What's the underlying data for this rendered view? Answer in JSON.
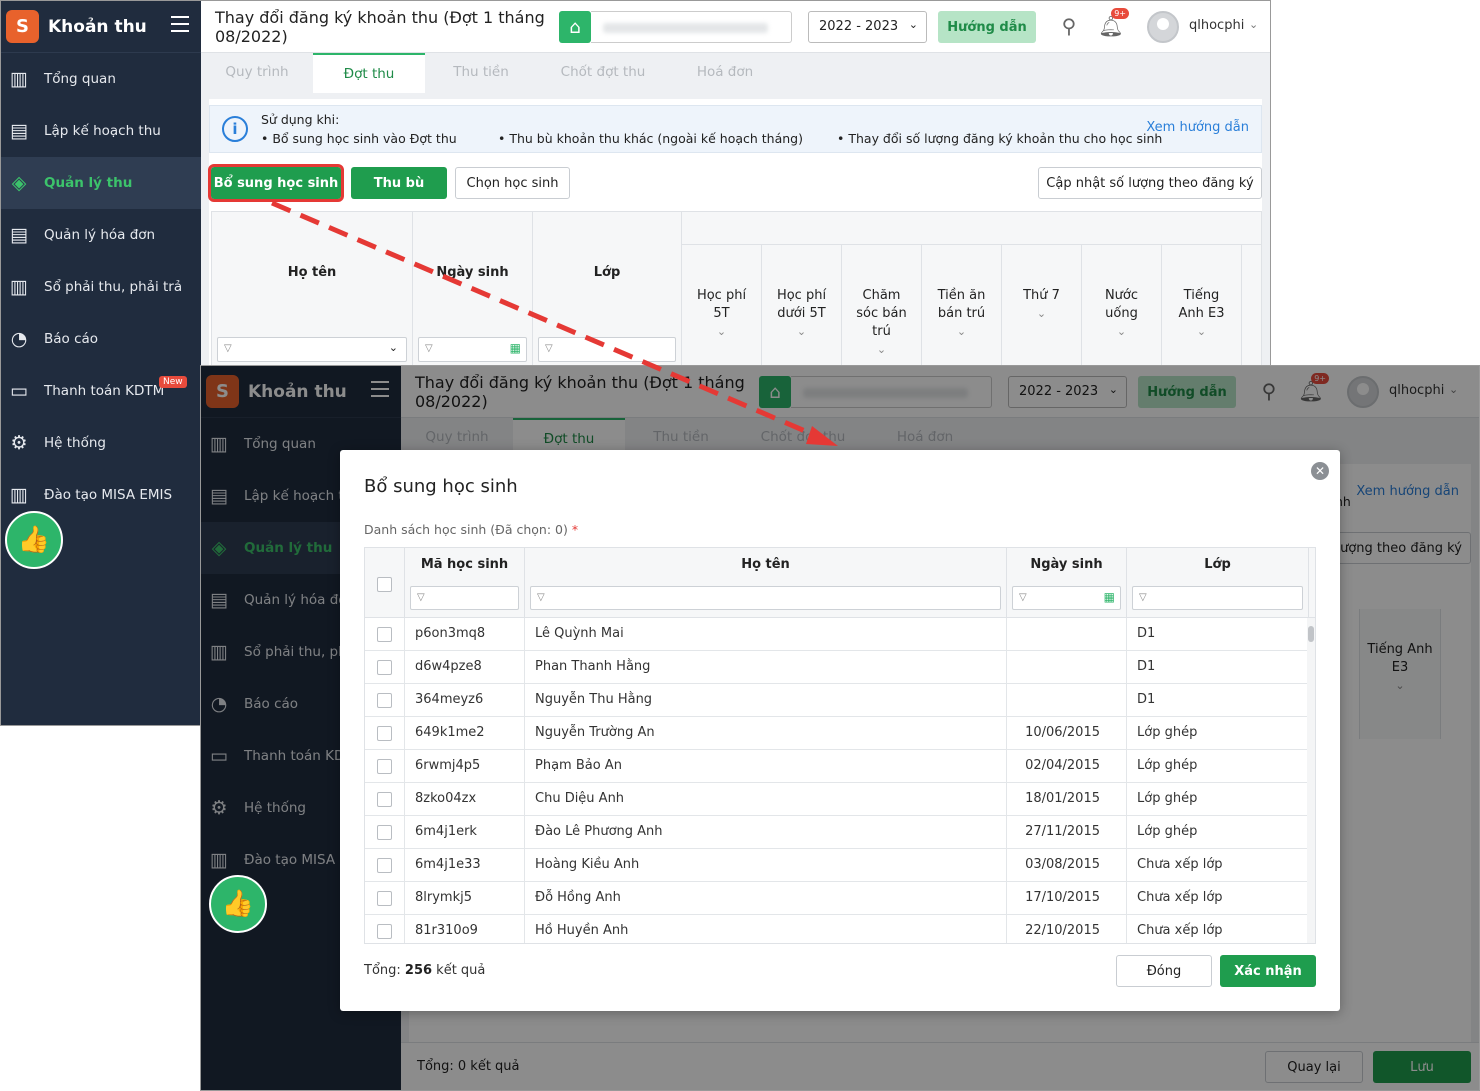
{
  "app": {
    "name": "Khoản thu",
    "logo_glyph": "S",
    "page_title": "Thay đổi đăng ký khoản thu (Đợt 1 tháng 08/2022)",
    "school_year": "2022 - 2023",
    "guide_label": "Hướng dẫn",
    "notif_count": "9+",
    "user_name": "qlhocphi",
    "accent_color": "#2db56a",
    "sidebar_color": "#202c3e"
  },
  "sidebar": {
    "items": [
      {
        "label": "Tổng quan",
        "icon": "bar-chart-icon"
      },
      {
        "label": "Lập kế hoạch thu",
        "icon": "calendar-dollar-icon"
      },
      {
        "label": "Quản lý thu",
        "icon": "hand-coin-icon",
        "active": true
      },
      {
        "label": "Quản lý hóa đơn",
        "icon": "document-icon"
      },
      {
        "label": "Sổ phải thu, phải trả",
        "icon": "ledger-book-icon"
      },
      {
        "label": "Báo cáo",
        "icon": "pie-chart-icon"
      },
      {
        "label": "Thanh toán KDTM",
        "icon": "card-check-icon",
        "badge": "New"
      },
      {
        "label": "Hệ thống",
        "icon": "gear-icon"
      },
      {
        "label": "Đào tạo MISA EMIS",
        "icon": "open-book-icon"
      }
    ]
  },
  "tabs": [
    "Quy trình",
    "Đợt thu",
    "Thu tiền",
    "Chốt đợt thu",
    "Hoá đơn"
  ],
  "info": {
    "title": "Sử dụng khi:",
    "lines": [
      "• Bổ sung học sinh vào Đợt thu",
      "• Thu bù khoản thu khác (ngoài kế hoạch tháng)",
      "• Thay đổi số lượng đăng ký khoản thu cho học sinh"
    ],
    "link": "Xem hướng dẫn"
  },
  "actions": {
    "add_students": "Bổ sung học sinh",
    "extra_charge": "Thu bù",
    "select_students": "Chọn học sinh",
    "update_qty": "Cập nhật số lượng theo đăng ký"
  },
  "grid": {
    "columns": [
      "Họ tên",
      "Ngày sinh",
      "Lớp"
    ],
    "fee_columns": [
      "Học phí 5T",
      "Học phí dưới 5T",
      "Chăm sóc bán trú",
      "Tiền ăn bán trú",
      "Thứ 7",
      "Nước uống",
      "Tiếng Anh E3"
    ],
    "total": "Tổng: 0 kết quả",
    "back_label": "Quay lại",
    "save_label": "Lưu",
    "partial_text_1": "nh",
    "partial_text_2": "ượng theo đăng ký"
  },
  "modal": {
    "title": "Bổ sung học sinh",
    "subtitle": "Danh sách học sinh (Đã chọn: 0)",
    "required_mark": "*",
    "columns": [
      "Mã học sinh",
      "Họ tên",
      "Ngày sinh",
      "Lớp"
    ],
    "rows": [
      {
        "id": "p6on3mq8",
        "name": "Lê Quỳnh Mai",
        "dob": "",
        "class": "D1"
      },
      {
        "id": "d6w4pze8",
        "name": "Phan Thanh Hằng",
        "dob": "",
        "class": "D1"
      },
      {
        "id": "364meyz6",
        "name": "Nguyễn Thu Hằng",
        "dob": "",
        "class": "D1"
      },
      {
        "id": "649k1me2",
        "name": "Nguyễn Trường An",
        "dob": "10/06/2015",
        "class": "Lớp ghép"
      },
      {
        "id": "6rwmj4p5",
        "name": "Phạm Bảo An",
        "dob": "02/04/2015",
        "class": "Lớp ghép"
      },
      {
        "id": "8zko04zx",
        "name": "Chu Diệu Anh",
        "dob": "18/01/2015",
        "class": "Lớp ghép"
      },
      {
        "id": "6m4j1erk",
        "name": "Đào Lê Phương Anh",
        "dob": "27/11/2015",
        "class": "Lớp ghép"
      },
      {
        "id": "6m4j1e33",
        "name": "Hoàng Kiều Anh",
        "dob": "03/08/2015",
        "class": "Chưa xếp lớp"
      },
      {
        "id": "8lrymkj5",
        "name": "Đỗ Hồng Anh",
        "dob": "17/10/2015",
        "class": "Chưa xếp lớp"
      },
      {
        "id": "81r310o9",
        "name": "Hồ Huyền Anh",
        "dob": "22/10/2015",
        "class": "Chưa xếp lớp"
      }
    ],
    "total_prefix": "Tổng: ",
    "total_count": "256",
    "total_suffix": " kết quả",
    "close_label": "Đóng",
    "confirm_label": "Xác nhận"
  }
}
